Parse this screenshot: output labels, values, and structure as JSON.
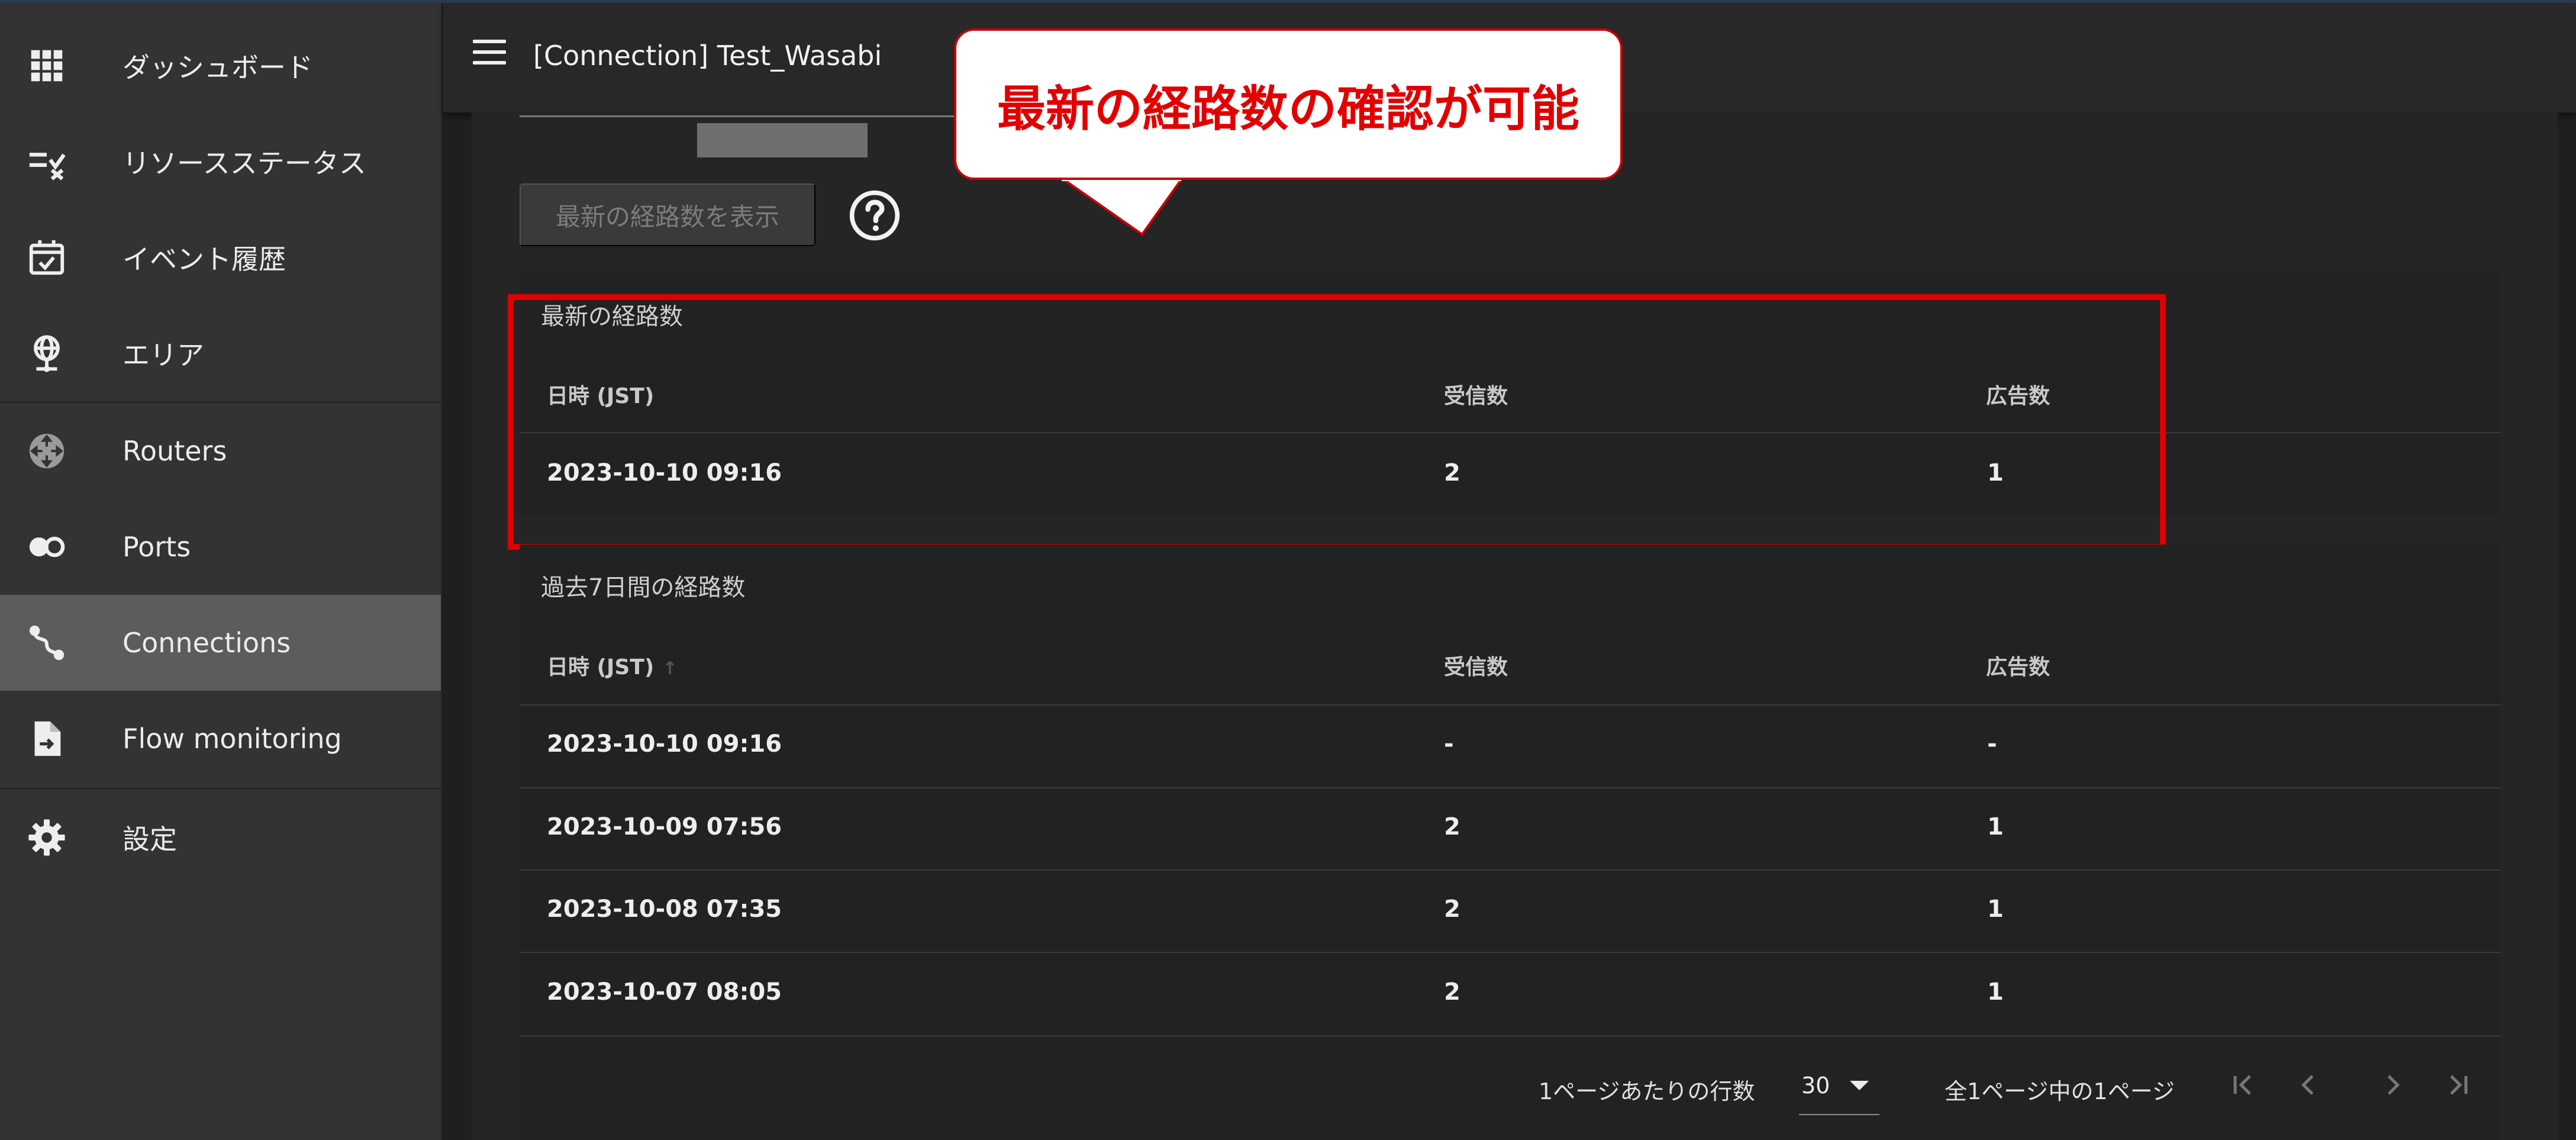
{
  "sidebar": {
    "items": [
      {
        "label": "ダッシュボード",
        "icon": "grid-icon"
      },
      {
        "label": "リソースステータス",
        "icon": "checklist-icon"
      },
      {
        "label": "イベント履歴",
        "icon": "calendar-check-icon"
      },
      {
        "label": "エリア",
        "icon": "globe-pin-icon"
      },
      {
        "label": "Routers",
        "icon": "router-icon"
      },
      {
        "label": "Ports",
        "icon": "port-icon"
      },
      {
        "label": "Connections",
        "icon": "connection-icon"
      },
      {
        "label": "Flow monitoring",
        "icon": "file-export-icon"
      },
      {
        "label": "設定",
        "icon": "gear-icon"
      }
    ],
    "active": "Connections"
  },
  "header": {
    "title": "[Connection] Test_Wasabi"
  },
  "main": {
    "show_button_label": "最新の経路数を表示"
  },
  "callout": {
    "text": "最新の経路数の確認が可能"
  },
  "latest": {
    "title": "最新の経路数",
    "columns": [
      "日時 (JST)",
      "受信数",
      "広告数"
    ],
    "rows": [
      [
        "2023-10-10 09:16",
        "2",
        "1"
      ]
    ]
  },
  "history": {
    "title": "過去7日間の経路数",
    "columns": [
      "日時 (JST)",
      "受信数",
      "広告数"
    ],
    "rows": [
      [
        "2023-10-10 09:16",
        "-",
        "-"
      ],
      [
        "2023-10-09 07:56",
        "2",
        "1"
      ],
      [
        "2023-10-08 07:35",
        "2",
        "1"
      ],
      [
        "2023-10-07 08:05",
        "2",
        "1"
      ]
    ]
  },
  "pagination": {
    "rows_per_page_label": "1ページあたりの行数",
    "rows_per_page_value": "30",
    "page_status": "全1ページ中の1ページ"
  },
  "colors": {
    "highlight": "#e00000",
    "active_nav": "#5c5c5c",
    "sidebar_bg": "#333333"
  }
}
